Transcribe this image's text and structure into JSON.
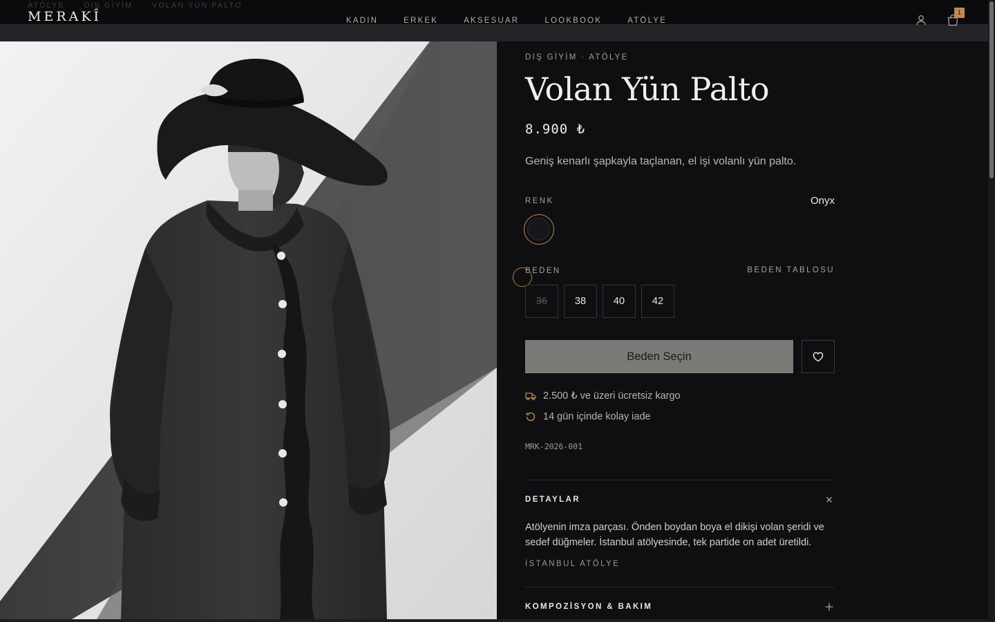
{
  "header": {
    "logo": "MERAKÎ",
    "ghost_breadcrumb": [
      "ATÖLYE",
      "·",
      "DIŞ GİYİM",
      "·",
      "VOLAN YÜN PALTO"
    ],
    "nav": [
      "KADIN",
      "ERKEK",
      "AKSESUAR",
      "LOOKBOOK",
      "ATÖLYE"
    ],
    "cart_count": "1",
    "icons": [
      "user-icon",
      "shopping-bag-icon"
    ]
  },
  "product": {
    "eyebrow": "DIŞ GİYİM · ATÖLYE",
    "title": "Volan Yün Palto",
    "price": "8.900 ₺",
    "description": "Geniş kenarlı şapkayla taçlanan, el işi volanlı yün palto.",
    "color_label": "RENK",
    "color_name": "Onyx",
    "swatch_color": "#16161c",
    "size_label": "BEDEN",
    "size_chart_label": "BEDEN TABLOSU",
    "sizes": [
      {
        "label": "36",
        "available": false
      },
      {
        "label": "38",
        "available": true
      },
      {
        "label": "40",
        "available": true
      },
      {
        "label": "42",
        "available": true
      }
    ],
    "cta_label": "Beden Seçin",
    "perks": [
      {
        "icon": "truck-icon",
        "text": "2.500 ₺ ve üzeri ücretsiz kargo"
      },
      {
        "icon": "return-icon",
        "text": "14 gün içinde kolay iade"
      }
    ],
    "sku": "MRK-2026-001"
  },
  "accordion": [
    {
      "title": "DETAYLAR",
      "open": true,
      "body": "Atölyenin imza parçası. Önden boydan boya el dikişi volan şeridi ve sedef düğmeler. İstanbul atölyesinde, tek partide on adet üretildi.",
      "origin": "İSTANBUL ATÖLYE"
    },
    {
      "title": "KOMPOZİSYON & BAKIM",
      "open": false
    }
  ],
  "colors": {
    "accent": "#c08a55",
    "background": "#0f0f12",
    "cta_bg": "#7c7a77"
  }
}
